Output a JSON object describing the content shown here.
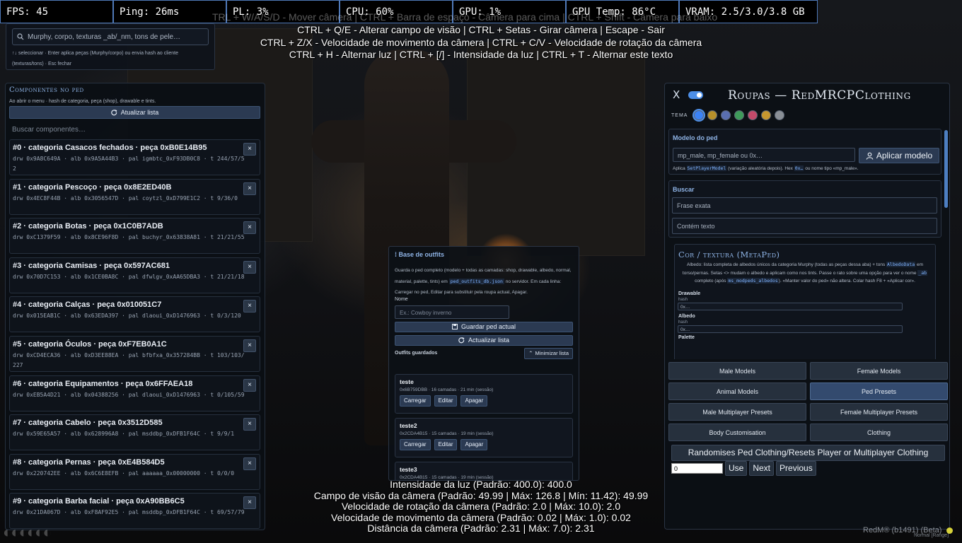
{
  "stats": [
    "FPS: 45",
    "Ping: 26ms",
    "PL: 3%",
    "CPU: 60%",
    "GPU: 1%",
    "GPU Temp: 86°C",
    "VRAM: 2.5/3.0/3.8 GB"
  ],
  "camera_help": {
    "ghost_line": "TRL + W/A/S/D - Mover câmera | CTRL + Barra de espaço - Câmera para cima | CTRL + Shift - Câmera para baixo",
    "lines": [
      "CTRL + Q/E - Alterar campo de visão | CTRL + Setas - Girar câmera | Escape - Sair",
      "CTRL + Z/X - Velocidade de movimento da câmera | CTRL + C/V - Velocidade de rotação da câmera",
      "CTRL + H - Alternar luz | CTRL + [/] - Intensidade da luz | CTRL + T - Alternar este texto"
    ]
  },
  "camera_stats": [
    "Intensidade da luz (Padrão: 400.0): 400.0",
    "Campo de visão da câmera (Padrão: 49.99 | Máx: 126.8 | Mín: 11.42): 49.99",
    "Velocidade de rotação da câmera (Padrão: 2.0 | Máx: 10.0): 2.0",
    "Velocidade de movimento da câmera (Padrão: 0.02 | Máx: 1.0): 0.02",
    "Distância da câmera (Padrão: 2.31 | Máx: 7.0): 2.31"
  ],
  "quick_search": {
    "placeholder": "Murphy, corpo, texturas _ab/_nm, tons de pele…",
    "hint": "↑↓ seleccionar · Enter aplica peças (Murphy/corpo) ou envia hash ao cliente (texturas/tons) · Esc fechar"
  },
  "components": {
    "title": "Componentes no ped",
    "subtitle": "Ao abrir o menu · hash de categoria, peça (shop), drawable e tints.",
    "refresh_label": "Atualizar lista",
    "search_placeholder": "Buscar componentes…",
    "items": [
      {
        "title": "#0 · categoria Casacos fechados · peça 0xB0E14B95",
        "meta": "drw 0x9A8C649A · alb 0x9A5A44B3 · pal igmbtc_0xF93DB0C8 · t 244/57/52"
      },
      {
        "title": "#1 · categoria Pescoço · peça 0x8E2ED40B",
        "meta": "drw 0x4EC8F44B · alb 0x3056547D · pal coytzl_0xD799E1C2 · t 9/36/0"
      },
      {
        "title": "#2 · categoria Botas · peça 0x1C0B7ADB",
        "meta": "drw 0xC1379F59 · alb 0x8CE96F8D · pal buchyr_0x63838A81 · t 21/21/55"
      },
      {
        "title": "#3 · categoria Camisas · peça 0x597AC681",
        "meta": "drw 0x70D7C153 · alb 0x1CE0BA8C · pal dfwlgv_0xAA65DBA3 · t 21/21/18"
      },
      {
        "title": "#4 · categoria Calças · peça 0x010051C7",
        "meta": "drw 0x015EAB1C · alb 0x63EDA397 · pal dlaoui_0xD1476963 · t 0/3/120"
      },
      {
        "title": "#5 · categoria Óculos · peça 0xF7EB0A1C",
        "meta": "drw 0xCD4ECA36 · alb 0xD3EE88EA · pal bfbfxa_0x357284BB · t 103/103/227"
      },
      {
        "title": "#6 · categoria Equipamentos · peça 0x6FFAEA18",
        "meta": "drw 0xEB5A4D21 · alb 0x04388256 · pal dlaoui_0xD1476963 · t 0/105/59"
      },
      {
        "title": "#7 · categoria Cabelo · peça 0x3512D585",
        "meta": "drw 0x59E65A57 · alb 0x628996A8 · pal msddbp_0xDFB1F64C · t 9/9/1"
      },
      {
        "title": "#8 · categoria Pernas · peça 0xE4B584D5",
        "meta": "drw 0x220742EE · alb 0x6C6E8EFB · pal aaaaaa_0x00000000 · t 0/0/0"
      },
      {
        "title": "#9 · categoria Barba facial · peça 0xA90BB6C5",
        "meta": "drw 0x21DA067D · alb 0xF8AF92E5 · pal msddbp_0xDFB1F64C · t 69/57/79"
      }
    ],
    "remove_label": "×"
  },
  "outfits": {
    "title": "Base de outfits",
    "desc_1": "Guarda o ped completo (modelo + todas as camadas: shop, drawable, albedo, normal, material, palette, tints) em ",
    "desc_code": "ped_outfits_db.json",
    "desc_2": " no servidor. Em cada linha: Carregar no ped, Editar para substituir pela roupa actual, Apagar.",
    "name_label": "Nome",
    "name_placeholder": "Ex.: Cowboy inverno",
    "save_label": "Guardar ped actual",
    "refresh_label": "Actualizar lista",
    "saved_label": "Outfits guardados",
    "minimize_label": "Minimizar lista",
    "load_label": "Carregar",
    "edit_label": "Editar",
    "delete_label": "Apagar",
    "items": [
      {
        "name": "teste",
        "meta": "0x6B759DBB · 16 camadas · 21 min (sessão)"
      },
      {
        "name": "teste2",
        "meta": "0x2CDA4B15 · 15 camadas · 19 min (sessão)"
      },
      {
        "name": "teste3",
        "meta": "0x2CDA4B15 · 15 camadas · 19 min (sessão)"
      }
    ]
  },
  "clothing": {
    "close_label": "X",
    "title": "Roupas — RedMRCPClothing",
    "theme_label": "TEMA",
    "theme_colors": [
      "#3b82f6",
      "#b8902a",
      "#5a6fb0",
      "#3f9a5a",
      "#c24a6a",
      "#c7972f",
      "#8a8f96"
    ],
    "model_title": "Modelo do ped",
    "model_placeholder": "mp_male, mp_female ou 0x…",
    "apply_model_label": "Aplicar modelo",
    "model_note_1": "Aplica ",
    "model_note_code": "SetPlayerModel",
    "model_note_2": " (variação aleatória depois). Hex ",
    "model_note_code2": "0x…",
    "model_note_3": " ou nome tipo «mp_male».",
    "search_title": "Buscar",
    "exact_placeholder": "Frase exata",
    "contains_placeholder": "Contém texto",
    "cor_title": "Cor / textura (MetaPed)",
    "cor_desc_1": "Albedo: lista completa de albedos únicos da categoria Murphy (todas as peças dessa aba) + tons ",
    "cor_desc_code1": "AlbedoData",
    "cor_desc_2": " em torso/pernas. Setas <> mudam o albedo e aplicam como nos tints. Passe o rato sobre uma opção para ver o nome ",
    "cor_desc_code2": "_ab",
    "cor_desc_3": " completo (após ",
    "cor_desc_code3": "ms_modpeds_albedos",
    "cor_desc_4": "). «Manter valor do ped» não altera. Colar hash F8 + «Aplicar cor».",
    "drawable_label": "Drawable",
    "hash_label": "hash",
    "albedo_label": "Albedo",
    "palette_label": "Palette",
    "hash_placeholder": "0x…",
    "grid_buttons": [
      "Male Models",
      "Female Models",
      "Animal Models",
      "Ped Presets",
      "Male Multiplayer Presets",
      "Female Multiplayer Presets",
      "Body Customisation",
      "Clothing"
    ],
    "active_grid_button": "Ped Presets",
    "randomise_label": "Randomises Ped Clothing/Resets Player or Multiplayer Clothing",
    "index_value": "0",
    "use_label": "Use",
    "next_label": "Next",
    "previous_label": "Previous"
  },
  "watermark": {
    "main": "RedM® (b1491) (Beta)",
    "sub": "Normal [Range]"
  }
}
